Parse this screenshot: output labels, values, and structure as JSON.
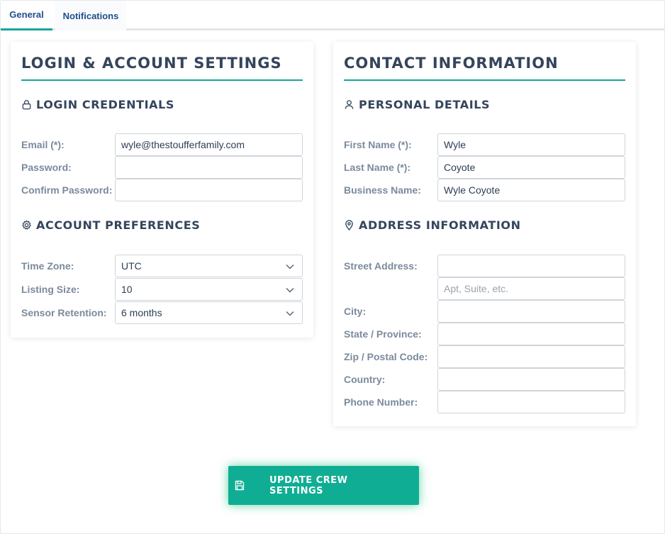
{
  "tabs": [
    {
      "label": "General",
      "active": true
    },
    {
      "label": "Notifications",
      "active": false
    }
  ],
  "login_card": {
    "title": "Login & Account Settings",
    "credentials": {
      "heading": "Login Credentials",
      "icon": "lock-icon",
      "email_label": "Email (*):",
      "email_value": "wyle@thestoufferfamily.com",
      "password_label": "Password:",
      "password_value": "",
      "confirm_label": "Confirm Password:",
      "confirm_value": ""
    },
    "preferences": {
      "heading": "Account Preferences",
      "icon": "gear-icon",
      "timezone_label": "Time Zone:",
      "timezone_value": "UTC",
      "listing_label": "Listing Size:",
      "listing_value": "10",
      "retention_label": "Sensor Retention:",
      "retention_value": "6 months"
    }
  },
  "contact_card": {
    "title": "Contact Information",
    "personal": {
      "heading": "Personal Details",
      "icon": "user-icon",
      "first_label": "First Name (*):",
      "first_value": "Wyle",
      "last_label": "Last Name (*):",
      "last_value": "Coyote",
      "business_label": "Business Name:",
      "business_value": "Wyle Coyote"
    },
    "address": {
      "heading": "Address Information",
      "icon": "map-pin-icon",
      "street_label": "Street Address:",
      "street_value": "",
      "street2_placeholder": "Apt, Suite, etc.",
      "city_label": "City:",
      "city_value": "",
      "state_label": "State / Province:",
      "state_value": "",
      "zip_label": "Zip / Postal Code:",
      "zip_value": "",
      "country_label": "Country:",
      "country_value": "",
      "phone_label": "Phone Number:",
      "phone_value": ""
    }
  },
  "submit": {
    "label": "Update Crew Settings",
    "icon": "save-icon"
  },
  "colors": {
    "accent": "#17a69a",
    "button": "#0fae94",
    "tab_text": "#1f4e8c",
    "heading": "#34455c",
    "label": "#7b8a9c"
  }
}
